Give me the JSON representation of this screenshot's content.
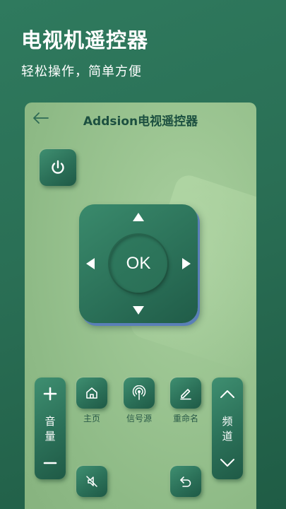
{
  "hero": {
    "title": "电视机遥控器",
    "subtitle": "轻松操作，简单方便"
  },
  "header": {
    "title": "Addsion电视遥控器",
    "back_icon": "arrow-left-icon"
  },
  "dpad": {
    "ok_label": "OK",
    "up_icon": "triangle-up-icon",
    "down_icon": "triangle-down-icon",
    "left_icon": "triangle-left-icon",
    "right_icon": "triangle-right-icon"
  },
  "power": {
    "icon": "power-icon"
  },
  "volume": {
    "label_1": "音",
    "label_2": "量",
    "plus_icon": "plus-icon",
    "minus_icon": "minus-icon"
  },
  "channel": {
    "label_1": "频",
    "label_2": "道",
    "up_icon": "chevron-up-icon",
    "down_icon": "chevron-down-icon"
  },
  "shortcuts": [
    {
      "label": "主页",
      "icon": "home-icon"
    },
    {
      "label": "信号源",
      "icon": "signal-icon"
    },
    {
      "label": "重命名",
      "icon": "edit-icon"
    }
  ],
  "bottom": {
    "mute_icon": "mute-icon",
    "return_icon": "return-icon"
  },
  "colors": {
    "background": "#2a6f55",
    "card": "#9dc693",
    "button": "#2b7058",
    "title_text": "#1c5040",
    "label_text": "#2a5a48",
    "dpad_shadow": "#5a7fb8"
  }
}
